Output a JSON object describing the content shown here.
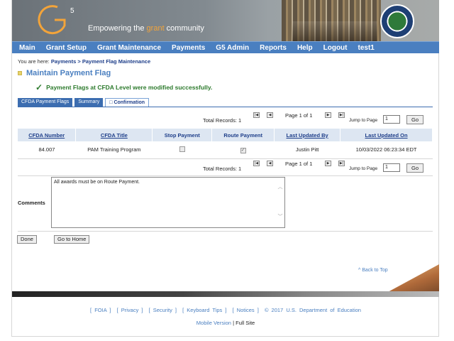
{
  "header": {
    "logo_mark": "G5",
    "tagline_pre": "Empowering the ",
    "tagline_accent": "grant",
    "tagline_post": " community"
  },
  "nav": [
    "Main",
    "Grant Setup",
    "Grant Maintenance",
    "Payments",
    "G5 Admin",
    "Reports",
    "Help",
    "Logout",
    "test1"
  ],
  "breadcrumb": {
    "prefix": "You are here:",
    "item1": "Payments",
    "separator": ">",
    "item2": "Payment Flag Maintenance"
  },
  "page_title": "Maintain Payment Flag",
  "success_message": "Payment Flags at CFDA Level were modified successfully.",
  "tabs": [
    "CFDA Payment Flags",
    "Summary",
    "Confirmation"
  ],
  "pager": {
    "total_label": "Total Records: 1",
    "page_label": "Page 1 of 1",
    "jump_label": "Jump to Page",
    "jump_value": "1",
    "go_label": "Go"
  },
  "table": {
    "headers": [
      "CFDA Number",
      "CFDA Title",
      "Stop Payment",
      "Route Payment",
      "Last Updated By",
      "Last Updated On"
    ],
    "row": {
      "cfda_number": "84.007",
      "cfda_title": "PAM Training Program",
      "stop_payment": false,
      "route_payment": true,
      "updated_by": "Justin Pitt",
      "updated_on": "10/03/2022 06:23:34 EDT"
    }
  },
  "comments": {
    "label": "Comments",
    "value": "All awards must be on Route Payment."
  },
  "buttons": {
    "done": "Done",
    "home": "Go to Home"
  },
  "back_to_top": "^ Back to Top",
  "footer": {
    "foia": "[ FOIA ]",
    "privacy": "[ Privacy ]",
    "security": "[ Security ]",
    "keyboard": "[ Keyboard Tips ]",
    "notices": "[ Notices ]",
    "copyright": "© 2017 U.S. Department of Education",
    "mobile": "Mobile Version",
    "divider": "|",
    "full_site": "Full Site"
  },
  "colors": {
    "nav_blue": "#4a7fc0",
    "success_green": "#2c7a2c",
    "accent_orange": "#f3a43a"
  }
}
